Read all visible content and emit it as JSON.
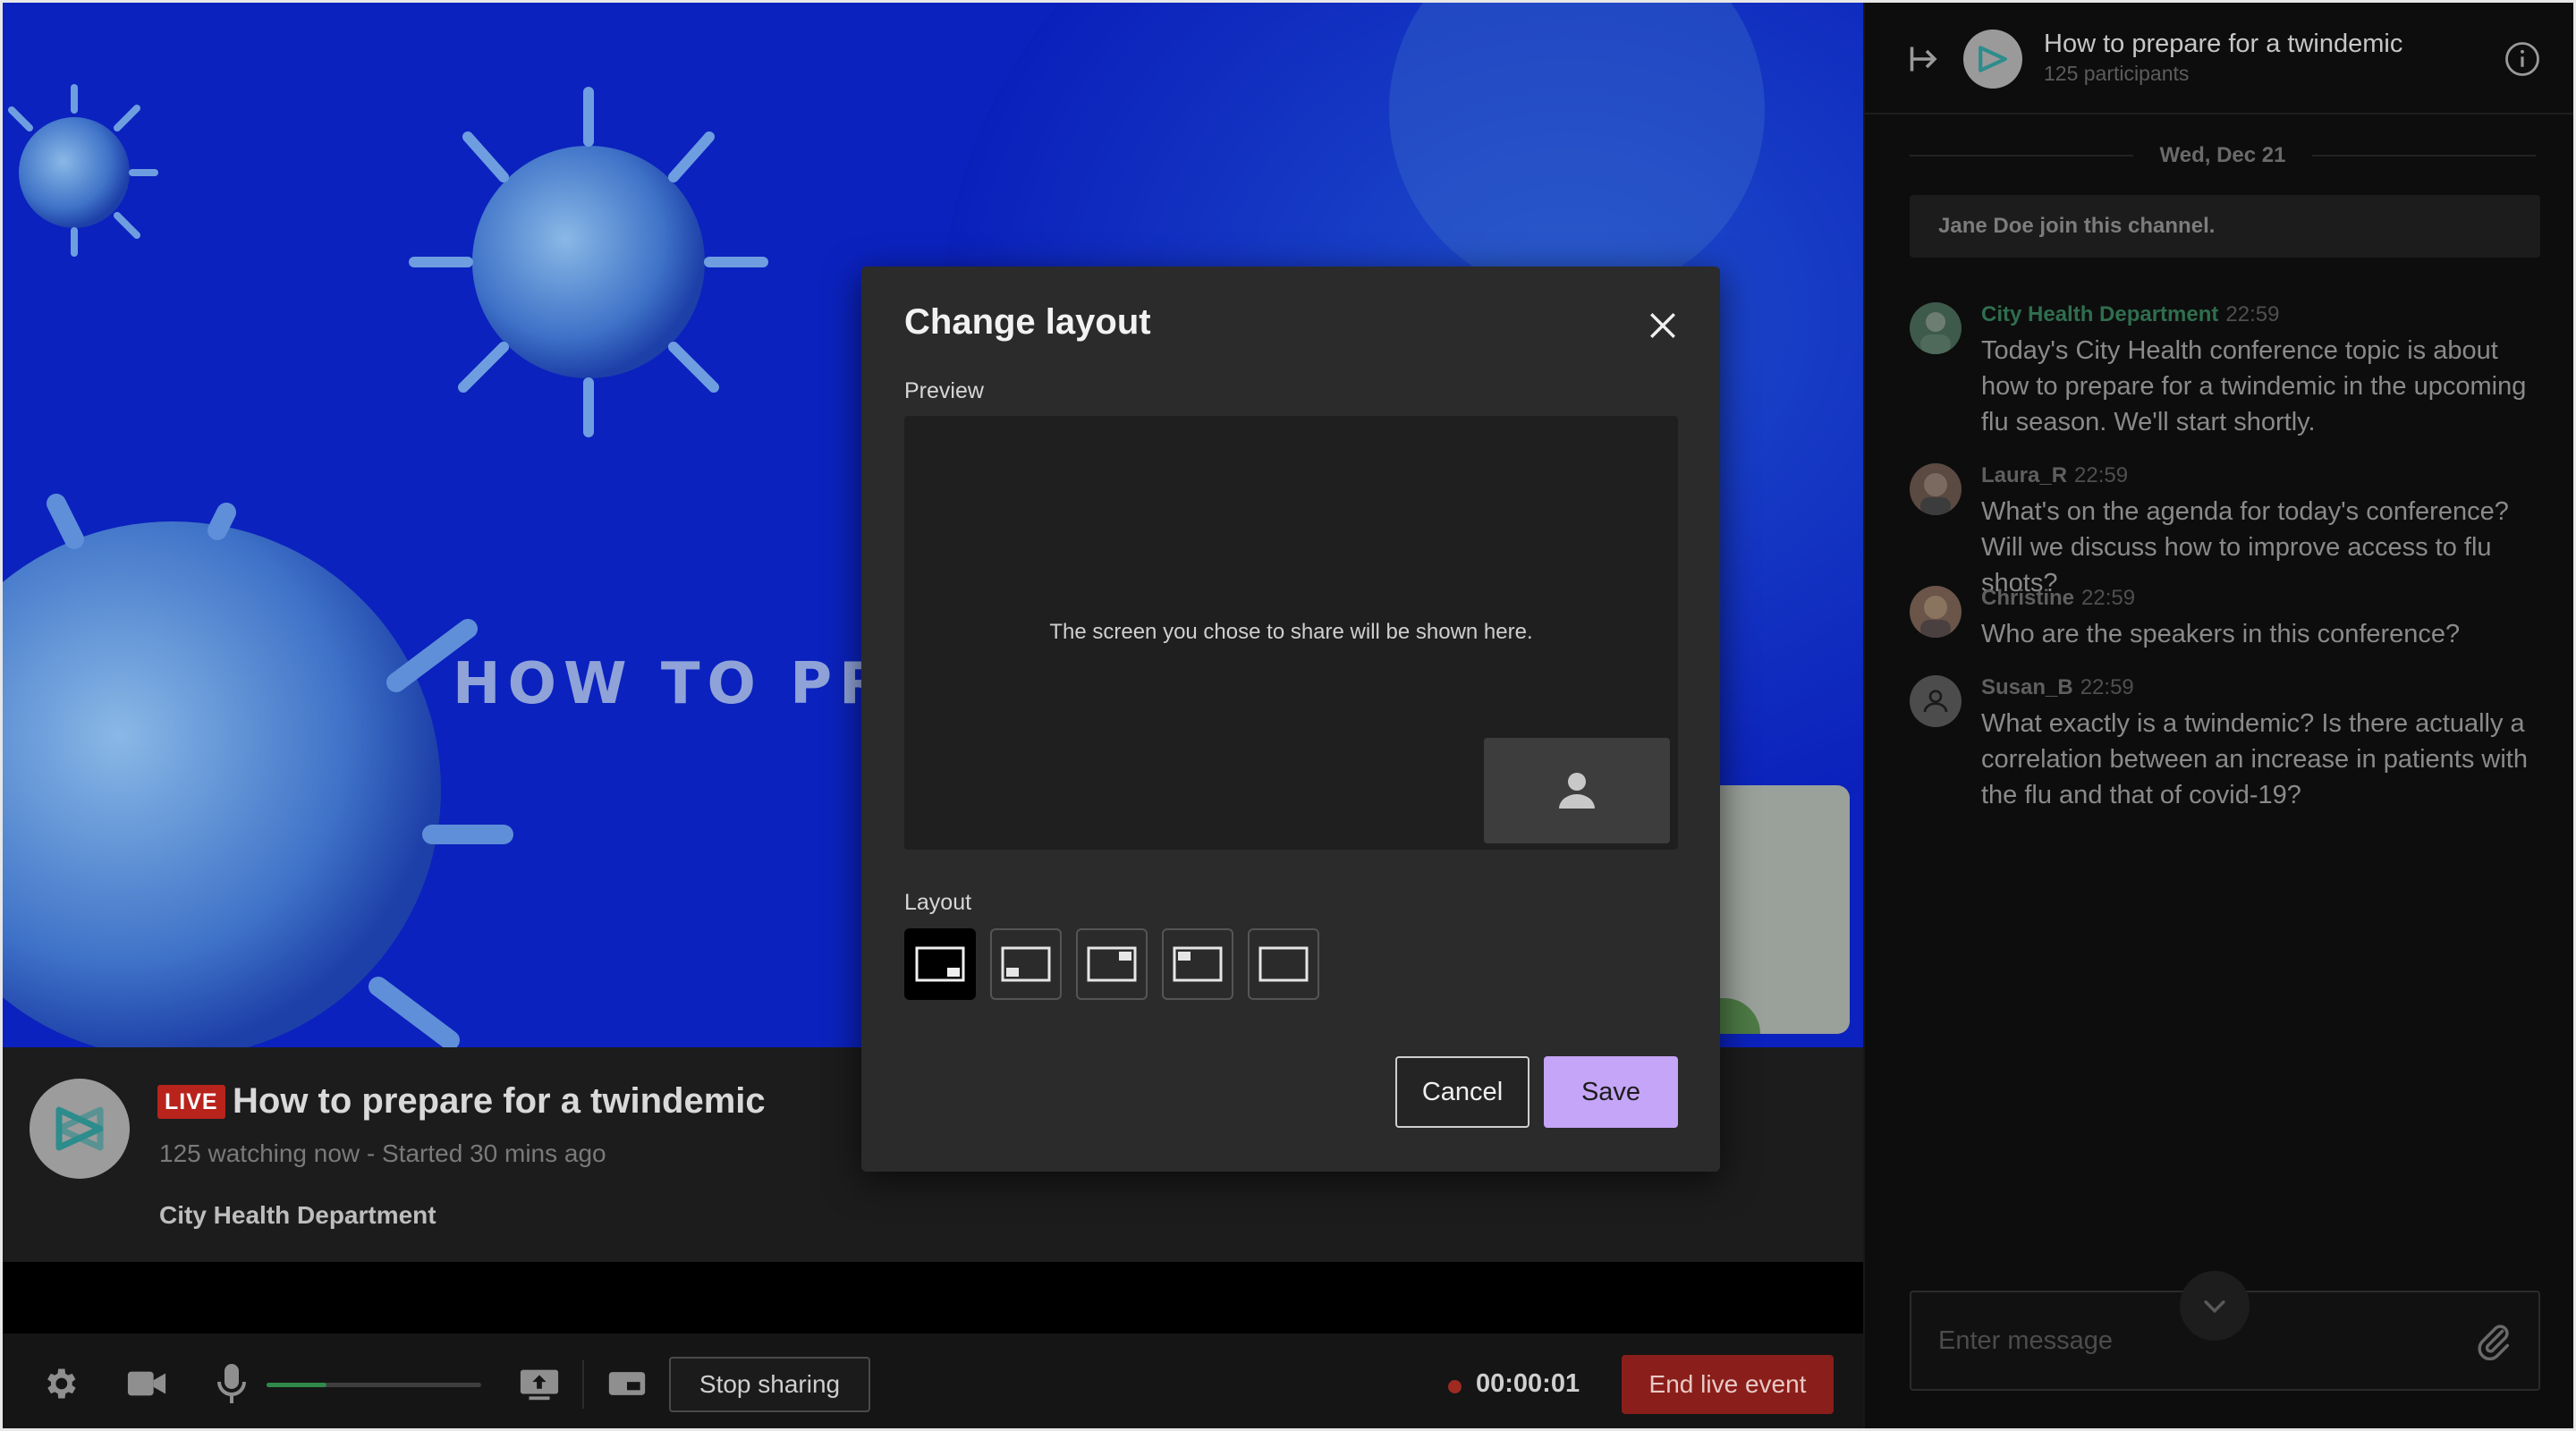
{
  "stage": {
    "slide_title": "HOW TO PRE"
  },
  "event": {
    "live_badge": "LIVE",
    "title": "How to prepare for a twindemic",
    "subtitle": "125 watching now - Started 30 mins ago",
    "organizer": "City Health Department"
  },
  "controls": {
    "icons": [
      "gear-icon",
      "camera-icon",
      "microphone-icon",
      "share-screen-icon",
      "picture-in-picture-icon"
    ],
    "volume_level": 0.28,
    "volume_color": "#2f8a4a",
    "stop_sharing_label": "Stop sharing",
    "timer": "00:00:01",
    "end_event_label": "End live event",
    "end_event_color": "#8a1e1a"
  },
  "chat": {
    "title": "How to prepare for a twindemic",
    "participants": "125 participants",
    "date": "Wed, Dec 21",
    "system_message": "Jane Doe join this channel.",
    "messages": [
      {
        "name": "City Health Department",
        "time": "22:59",
        "text": "Today's City Health conference topic is about how to prepare for a twindemic in the upcoming flu season. We'll start shortly."
      },
      {
        "name": "Laura_R",
        "time": "22:59",
        "text": "What's on the agenda for today's conference? Will we discuss how to improve access to flu shots?"
      },
      {
        "name": "Christine",
        "time": "22:59",
        "text": "Who are the speakers in this conference?"
      },
      {
        "name": "Susan_B",
        "time": "22:59",
        "text": "What exactly is a twindemic? Is there actually a correlation between an increase in patients with the flu and that of covid-19?"
      }
    ],
    "composer_placeholder": "Enter message"
  },
  "modal": {
    "title": "Change layout",
    "preview_label": "Preview",
    "preview_text": "The screen you chose to share will be shown here.",
    "layout_label": "Layout",
    "layout_options": [
      "pip-bottom-right",
      "pip-bottom-left",
      "pip-top-right",
      "pip-top-left",
      "screen-only"
    ],
    "selected_layout": "pip-bottom-right",
    "cancel_label": "Cancel",
    "save_label": "Save",
    "save_color": "#c5a5f7"
  }
}
